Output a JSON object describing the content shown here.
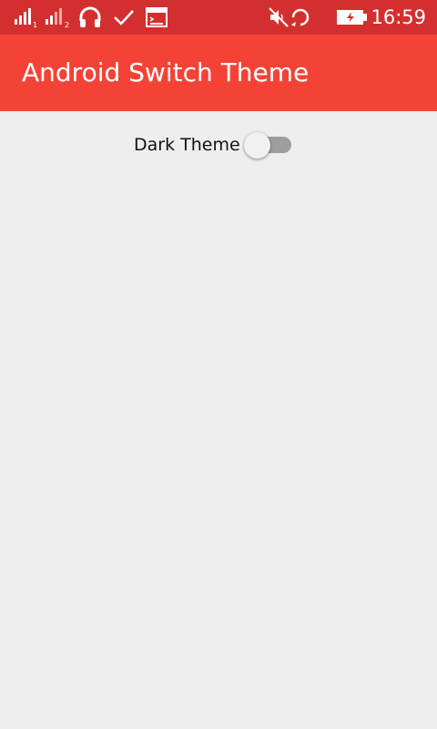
{
  "status_bar": {
    "icons": [
      "signal-sim1-icon",
      "signal-sim2-icon",
      "headphones-icon",
      "check-icon",
      "screen-icon",
      "mute-icon",
      "sync-icon",
      "battery-charging-icon"
    ],
    "sim1_index": "1",
    "sim2_index": "2",
    "time": "16:59",
    "background": "#d32f2f"
  },
  "app_bar": {
    "title": "Android Switch Theme",
    "background": "#f44336"
  },
  "content": {
    "switch_label": "Dark Theme",
    "switch_checked": false
  }
}
